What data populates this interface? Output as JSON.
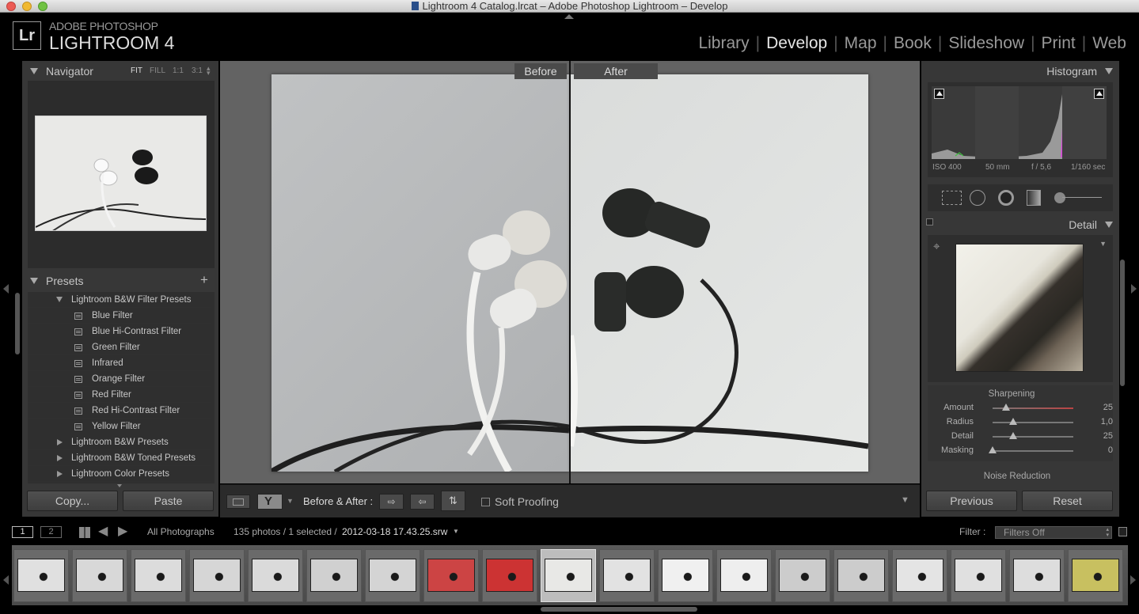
{
  "window": {
    "title": "Lightroom 4 Catalog.lrcat – Adobe Photoshop Lightroom – Develop"
  },
  "identity": {
    "logo": "Lr",
    "brand_top": "ADOBE PHOTOSHOP",
    "brand_main": "LIGHTROOM 4"
  },
  "modules": [
    "Library",
    "Develop",
    "Map",
    "Book",
    "Slideshow",
    "Print",
    "Web"
  ],
  "active_module": "Develop",
  "navigator": {
    "title": "Navigator",
    "zoom_options": [
      "FIT",
      "FILL",
      "1:1",
      "3:1"
    ]
  },
  "presets": {
    "title": "Presets",
    "add_label": "+",
    "open_folder": "Lightroom B&W Filter Presets",
    "items": [
      "Blue Filter",
      "Blue Hi-Contrast Filter",
      "Green Filter",
      "Infrared",
      "Orange Filter",
      "Red Filter",
      "Red Hi-Contrast Filter",
      "Yellow Filter"
    ],
    "closed_folders": [
      "Lightroom B&W Presets",
      "Lightroom B&W Toned Presets",
      "Lightroom Color Presets"
    ]
  },
  "left_buttons": {
    "copy": "Copy...",
    "paste": "Paste"
  },
  "compare": {
    "before": "Before",
    "after": "After"
  },
  "toolbar": {
    "before_after_label": "Before & After :",
    "soft_proofing": "Soft Proofing"
  },
  "histogram": {
    "title": "Histogram",
    "iso": "ISO 400",
    "focal": "50 mm",
    "aperture": "f / 5,6",
    "shutter": "1/160 sec"
  },
  "detail": {
    "title": "Detail",
    "sharpening_title": "Sharpening",
    "sliders": [
      {
        "label": "Amount",
        "value": "25",
        "fraction": 0.17
      },
      {
        "label": "Radius",
        "value": "1,0",
        "fraction": 0.25
      },
      {
        "label": "Detail",
        "value": "25",
        "fraction": 0.25
      },
      {
        "label": "Masking",
        "value": "0",
        "fraction": 0.0
      }
    ],
    "noise_title": "Noise Reduction"
  },
  "right_buttons": {
    "previous": "Previous",
    "reset": "Reset"
  },
  "filmbar": {
    "page1": "1",
    "page2": "2",
    "source": "All Photographs",
    "count": "135 photos / 1 selected /",
    "filename": "2012-03-18 17.43.25.srw",
    "filter_label": "Filter :",
    "filter_value": "Filters Off"
  },
  "film_thumb_count": 19,
  "film_selected_index": 9,
  "colors": {
    "panel": "#373737",
    "center_bg": "#636363",
    "app_bg": "#000000"
  }
}
